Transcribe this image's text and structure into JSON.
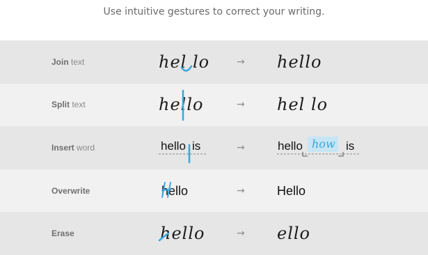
{
  "header": {
    "subtitle": "Use intuitive gestures to correct your writing."
  },
  "arrow": "→",
  "rows": [
    {
      "label_bold": "Join",
      "label_rest": " text",
      "before": "hel lo",
      "after": "hello"
    },
    {
      "label_bold": "Split",
      "label_rest": " text",
      "before": "hello",
      "after": "hel lo"
    },
    {
      "label_bold": "Insert",
      "label_rest": " word",
      "before_a": "hello",
      "before_b": "is",
      "after_a": "hello",
      "after_ins": "how",
      "after_b": "is"
    },
    {
      "label_bold": "Overwrite",
      "label_rest": "",
      "before": "hello",
      "after": "Hello"
    },
    {
      "label_bold": "Erase",
      "label_rest": "",
      "before": "hello",
      "after": "ello"
    }
  ],
  "colors": {
    "accent": "#38a7de",
    "row_dark": "#e6e6e6",
    "row_light": "#f1f1f1"
  }
}
